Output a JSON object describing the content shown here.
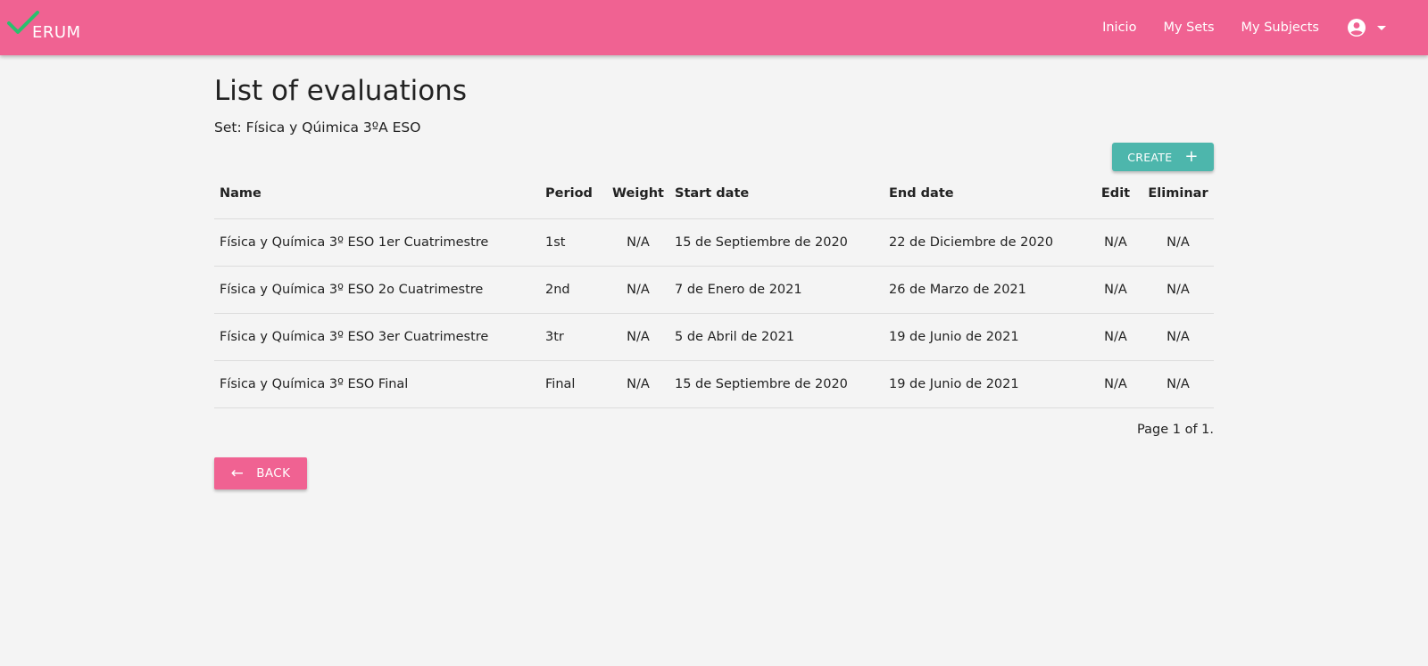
{
  "navbar": {
    "brand_text": "ERUM",
    "links": [
      "Inicio",
      "My Sets",
      "My Subjects"
    ],
    "account_icon": "account-circle-icon",
    "dropdown_icon": "caret-down-icon"
  },
  "colors": {
    "navbar": "#f06292",
    "accent_teal": "#4db6ac",
    "check_green": "#2bbf6e",
    "background": "#f4f4f4"
  },
  "main": {
    "title": "List of evaluations",
    "subtitle": "Set: Física y Qúimica 3ºA ESO",
    "create_label": "CREATE",
    "create_icon": "plus-icon",
    "back_label": "BACK",
    "back_icon": "arrow-left-icon",
    "page_info": "Page 1 of 1."
  },
  "table": {
    "headers": [
      "Name",
      "Period",
      "Weight",
      "Start date",
      "End date",
      "Edit",
      "Eliminar"
    ],
    "rows": [
      [
        "Física y Química 3º ESO 1er Cuatrimestre",
        "1st",
        "N/A",
        "15 de Septiembre de 2020",
        "22 de Diciembre de 2020",
        "N/A",
        "N/A"
      ],
      [
        "Física y Química 3º ESO 2o Cuatrimestre",
        "2nd",
        "N/A",
        "7 de Enero de 2021",
        "26 de Marzo de 2021",
        "N/A",
        "N/A"
      ],
      [
        "Física y Química 3º ESO 3er Cuatrimestre",
        "3tr",
        "N/A",
        "5 de Abril de 2021",
        "19 de Junio de 2021",
        "N/A",
        "N/A"
      ],
      [
        "Física y Química 3º ESO Final",
        "Final",
        "N/A",
        "15 de Septiembre de 2020",
        "19 de Junio de 2021",
        "N/A",
        "N/A"
      ]
    ]
  }
}
